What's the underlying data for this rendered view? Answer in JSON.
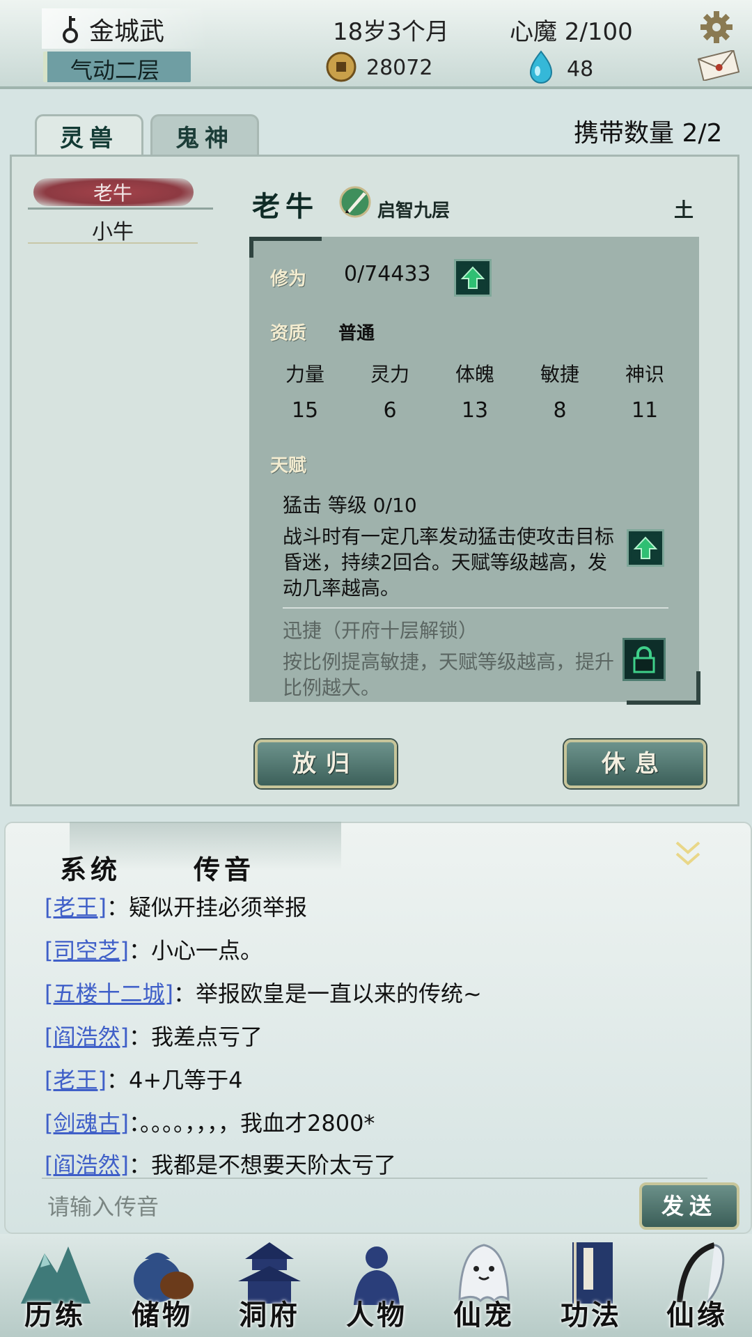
{
  "header": {
    "player_name": "金城武",
    "realm": "气动二层",
    "age": "18岁3个月",
    "demon": "心魔  2/100",
    "coins": "28072",
    "jade": "48"
  },
  "tabs": [
    "灵兽",
    "鬼神"
  ],
  "carry": "携带数量    2/2",
  "pets": [
    "老牛",
    "小牛"
  ],
  "selected_pet": {
    "name": "老牛",
    "rank": "启智九层",
    "element": "土",
    "cultivation_label": "修为",
    "cultivation_value": "0/74433",
    "aptitude_label": "资质",
    "aptitude_value": "普通",
    "stats": [
      {
        "name": "力量",
        "value": "15"
      },
      {
        "name": "灵力",
        "value": "6"
      },
      {
        "name": "体魄",
        "value": "13"
      },
      {
        "name": "敏捷",
        "value": "8"
      },
      {
        "name": "神识",
        "value": "11"
      }
    ],
    "talent_label": "天赋",
    "talent1_title": "猛击    等级  0/10",
    "talent1_desc": "战斗时有一定几率发动猛击使攻击目标昏迷，持续2回合。天赋等级越高，发动几率越高。",
    "talent2_title": "迅捷（开府十层解锁）",
    "talent2_desc": "按比例提高敏捷，天赋等级越高，提升比例越大。"
  },
  "buttons": {
    "release": "放归",
    "rest": "休息",
    "send": "发送"
  },
  "chat": {
    "tabs": [
      "系统",
      "传音"
    ],
    "messages": [
      {
        "user": "[老王]",
        "text": "：疑似开挂必须举报"
      },
      {
        "user": "[司空芝]",
        "text": "：小心一点。"
      },
      {
        "user": "[五楼十二城]",
        "text": "：举报欧皇是一直以来的传统~"
      },
      {
        "user": "[阎浩然]",
        "text": "：我差点亏了"
      },
      {
        "user": "[老王]",
        "text": "：4+几等于4"
      },
      {
        "user": "[剑魂古]",
        "text": "：。。。。，，，，我血才2800*"
      },
      {
        "user": "[阎浩然]",
        "text": "：我都是不想要天阶太亏了"
      }
    ],
    "placeholder": "请输入传音"
  },
  "nav": [
    "历练",
    "储物",
    "洞府",
    "人物",
    "仙宠",
    "功法",
    "仙缘"
  ],
  "colors": {
    "accent": "#3f5fc8",
    "button": "#4f7770",
    "panel": "#d7e3df"
  }
}
